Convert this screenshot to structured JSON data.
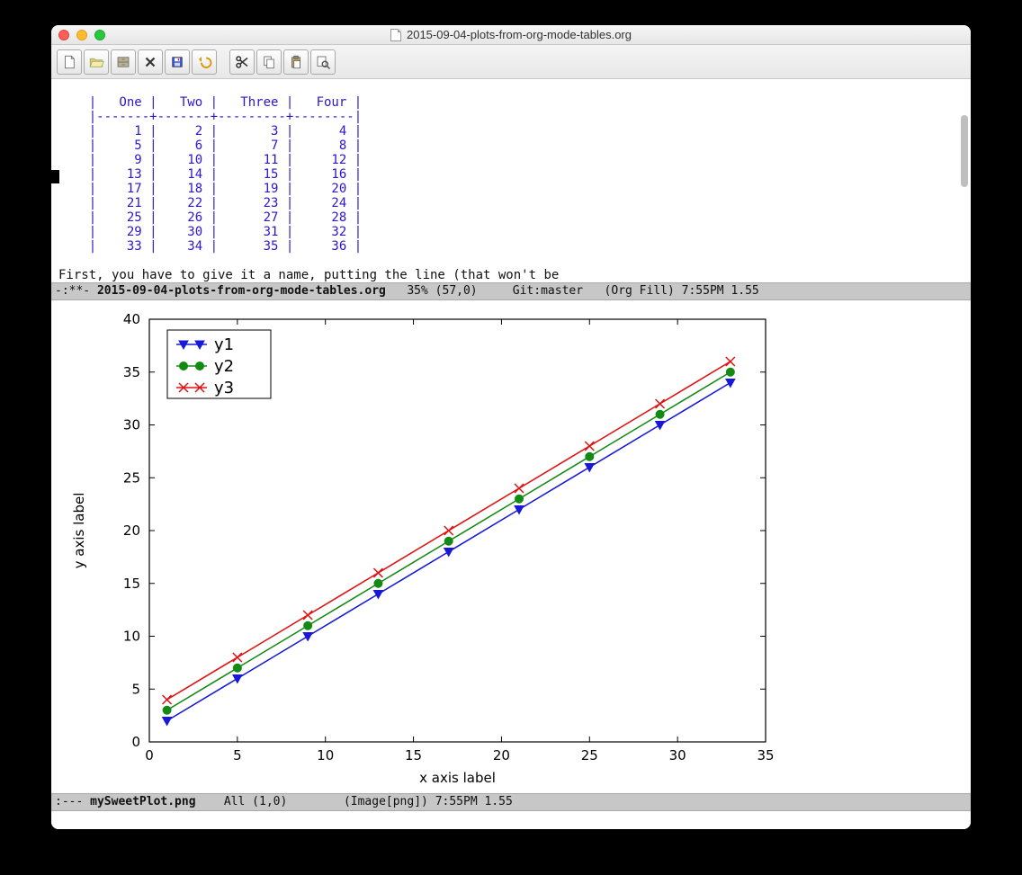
{
  "window": {
    "title": "2015-09-04-plots-from-org-mode-tables.org"
  },
  "toolbar_icons": [
    "new-file",
    "open-file",
    "dired",
    "kill-buffer",
    "save",
    "undo",
    "cut",
    "copy",
    "paste",
    "search"
  ],
  "org_table": {
    "headers": [
      "One",
      "Two",
      "Three",
      "Four"
    ],
    "rows": [
      [
        1,
        2,
        3,
        4
      ],
      [
        5,
        6,
        7,
        8
      ],
      [
        9,
        10,
        11,
        12
      ],
      [
        13,
        14,
        15,
        16
      ],
      [
        17,
        18,
        19,
        20
      ],
      [
        21,
        22,
        23,
        24
      ],
      [
        25,
        26,
        27,
        28
      ],
      [
        29,
        30,
        31,
        32
      ],
      [
        33,
        34,
        35,
        36
      ]
    ]
  },
  "prose_line": "First, you have to give it a name, putting the line (that won't be",
  "modeline_top": {
    "prefix": "-:**- ",
    "file": "2015-09-04-plots-from-org-mode-tables.org",
    "percent": "35%",
    "pos": "(57,0)",
    "vc": "Git:master",
    "mode": "(Org Fill)",
    "time": "7:55PM",
    "load": "1.55"
  },
  "modeline_bottom": {
    "prefix": ":--- ",
    "file": "mySweetPlot.png",
    "percent": "All",
    "pos": "(1,0)",
    "mode": "(Image[png])",
    "time": "7:55PM",
    "load": "1.55"
  },
  "chart_data": {
    "type": "line",
    "xlabel": "x axis label",
    "ylabel": "y axis label",
    "xlim": [
      0,
      35
    ],
    "ylim": [
      0,
      40
    ],
    "xticks": [
      0,
      5,
      10,
      15,
      20,
      25,
      30,
      35
    ],
    "yticks": [
      0,
      5,
      10,
      15,
      20,
      25,
      30,
      35,
      40
    ],
    "x": [
      1,
      5,
      9,
      13,
      17,
      21,
      25,
      29,
      33
    ],
    "series": [
      {
        "name": "y1",
        "color": "#1818d8",
        "marker": "triangle-down",
        "values": [
          2,
          6,
          10,
          14,
          18,
          22,
          26,
          30,
          34
        ]
      },
      {
        "name": "y2",
        "color": "#138a13",
        "marker": "circle",
        "values": [
          3,
          7,
          11,
          15,
          19,
          23,
          27,
          31,
          35
        ]
      },
      {
        "name": "y3",
        "color": "#e01010",
        "marker": "x",
        "values": [
          4,
          8,
          12,
          16,
          20,
          24,
          28,
          32,
          36
        ]
      }
    ],
    "legend_pos": "upper-left"
  }
}
